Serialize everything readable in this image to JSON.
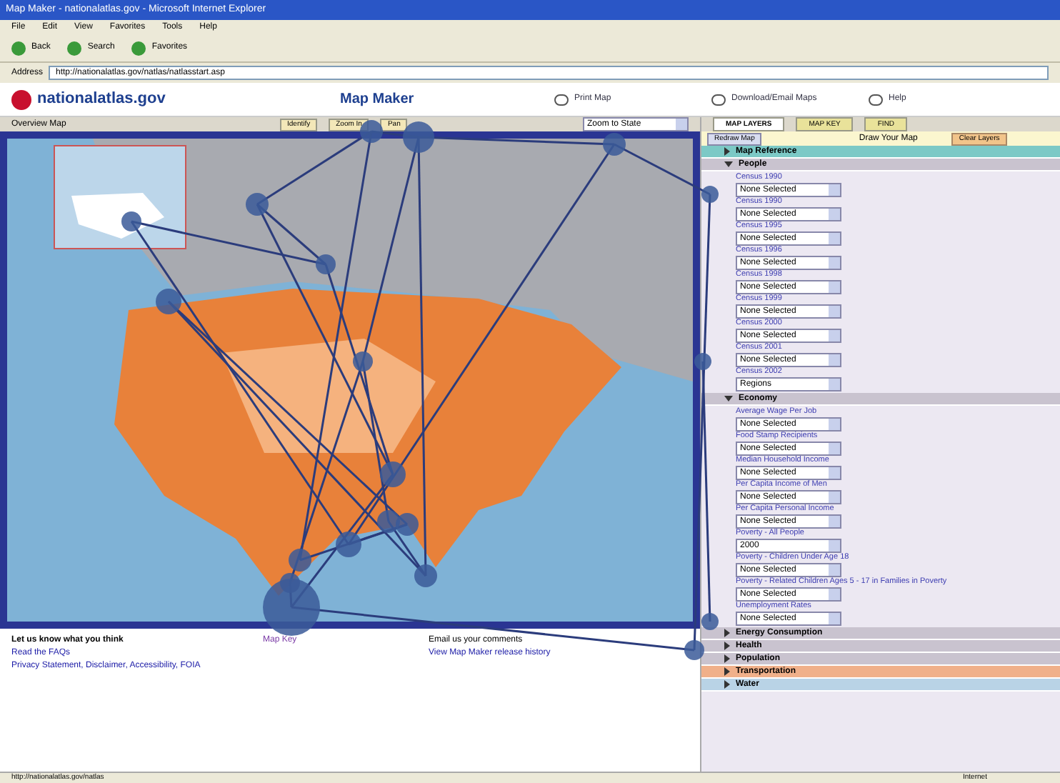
{
  "window": {
    "title": "Map Maker - nationalatlas.gov - Microsoft Internet Explorer"
  },
  "menu": [
    "File",
    "Edit",
    "View",
    "Favorites",
    "Tools",
    "Help"
  ],
  "toolbar": [
    "Back",
    "Search",
    "Favorites"
  ],
  "address": {
    "label": "Address",
    "value": "http://nationalatlas.gov/natlas/natlasstart.asp"
  },
  "site": {
    "logo": "nationalatlas.gov",
    "title": "Map Maker",
    "links": [
      "Print Map",
      "Download/Email Maps",
      "Help"
    ]
  },
  "map_toolbar": {
    "label": "Overview Map",
    "buttons": [
      "Identify",
      "Zoom In",
      "Pan"
    ],
    "select": "Zoom to State"
  },
  "panel": {
    "tabs": [
      {
        "label": "MAP LAYERS",
        "selected": true
      },
      {
        "label": "MAP KEY",
        "selected": false
      },
      {
        "label": "FIND",
        "selected": false
      }
    ],
    "redraw": "Redraw Map",
    "caption": "Draw Your Map",
    "clear": "Clear Layers",
    "sections": [
      {
        "title": "Map Reference",
        "color": "#7cc9c6",
        "expanded": false
      },
      {
        "title": "People",
        "color": "#c9c3cf",
        "expanded": true,
        "fields": [
          {
            "label": "Census 1990",
            "value": "None Selected"
          },
          {
            "label": "Census 1990",
            "value": "None Selected"
          },
          {
            "label": "Census 1995",
            "value": "None Selected"
          },
          {
            "label": "Census 1996",
            "value": "None Selected"
          },
          {
            "label": "Census 1998",
            "value": "None Selected"
          },
          {
            "label": "Census 1999",
            "value": "None Selected"
          },
          {
            "label": "Census 2000",
            "value": "None Selected"
          },
          {
            "label": "Census 2001",
            "value": "None Selected"
          },
          {
            "label": "Census 2002",
            "value": "Regions"
          }
        ]
      },
      {
        "title": "Economy",
        "color": "#c9c3cf",
        "expanded": true,
        "fields": [
          {
            "label": "Average Wage Per Job",
            "value": "None Selected"
          },
          {
            "label": "Food Stamp Recipients",
            "value": "None Selected"
          },
          {
            "label": "Median Household Income",
            "value": "None Selected"
          },
          {
            "label": "Per Capita Income of Men",
            "value": "None Selected"
          },
          {
            "label": "Per Capita Personal Income",
            "value": "None Selected"
          },
          {
            "label": "Poverty - All People",
            "value": "2000"
          },
          {
            "label": "Poverty - Children Under Age 18",
            "value": "None Selected"
          },
          {
            "label": "Poverty - Related Children Ages 5 - 17 in Families in Poverty",
            "value": "None Selected"
          },
          {
            "label": "Unemployment Rates",
            "value": "None Selected"
          }
        ]
      },
      {
        "title": "Energy Consumption",
        "color": "#c9c3cf",
        "expanded": false
      },
      {
        "title": "Health",
        "color": "#c9c3cf",
        "expanded": false
      },
      {
        "title": "Population",
        "color": "#c9c3cf",
        "expanded": false
      },
      {
        "title": "Transportation",
        "color": "#f0b08a",
        "expanded": false
      },
      {
        "title": "Water",
        "color": "#b9d3e6",
        "expanded": false
      }
    ]
  },
  "footer": {
    "heading": "Let us know what you think",
    "links": [
      "Read the FAQs",
      "Privacy Statement, Disclaimer, Accessibility, FOIA"
    ],
    "center": "Map Key",
    "right_heading": "Email us your comments",
    "right_link": "View Map Maker release history"
  },
  "status_bar": {
    "text": "http://nationalatlas.gov/natlas",
    "zone": "Internet"
  }
}
